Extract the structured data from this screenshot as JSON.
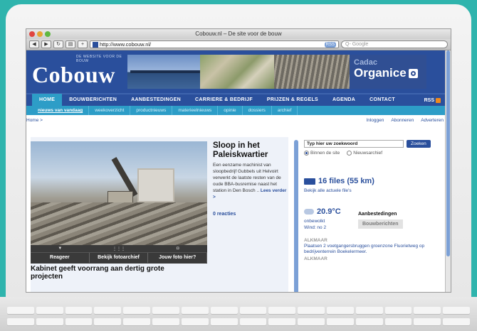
{
  "browser": {
    "window_title": "Cobouw.nl – De site voor de bouw",
    "url": "http://www.cobouw.nl/",
    "rss_badge": "RSS",
    "search_placeholder": "Q- Google",
    "traffic_light_colors": [
      "#e0443e",
      "#e6a532",
      "#5fb840"
    ]
  },
  "site": {
    "logo_tagline": "DE WEBSITE VOOR DE BOUW",
    "logo": "Cobouw",
    "banner_kicker": "Cadac",
    "banner_brand": "Organice",
    "brand_color": "#2a4f9c",
    "accent_color": "#2d9dc7"
  },
  "nav": {
    "items": [
      {
        "label": "HOME",
        "active": true
      },
      {
        "label": "BOUWBERICHTEN",
        "active": false
      },
      {
        "label": "AANBESTEDINGEN",
        "active": false
      },
      {
        "label": "CARRIERE & BEDRIJF",
        "active": false
      },
      {
        "label": "PRIJZEN & REGELS",
        "active": false
      },
      {
        "label": "AGENDA",
        "active": false
      },
      {
        "label": "CONTACT",
        "active": false
      }
    ],
    "rss_label": "RSS"
  },
  "subnav": {
    "items": [
      "nieuws van vandaag",
      "weekoverzicht",
      "productnieuws",
      "materieelnieuws",
      "opinie",
      "dossiers",
      "archief"
    ]
  },
  "breadcrumb": "Home >",
  "user_links": [
    "Inloggen",
    "Abonneren",
    "Adverteren"
  ],
  "feature": {
    "controls": [
      "Reageer",
      "Bekijk fotoarchief",
      "Jouw foto hier?"
    ],
    "second_headline": "Kabinet geeft voorrang aan dertig grote projecten"
  },
  "article": {
    "title": "Sloop in het Paleiskwartier",
    "body": "Een eenzame machinist van sloopbedrijf Gubbels uit Helvoirt verwerkt de laatste resten van de oude BBA-busremise naast het station in Den Bosch ..",
    "more": "Lees verder >",
    "reactions": "0 reacties"
  },
  "sidebar": {
    "search_value": "Typ hier uw zoekwoord",
    "search_button": "Zoeken",
    "radio_site": "Binnen de site",
    "radio_archive": "Nieuwsarchief",
    "files_title": "16 files (55 km)",
    "files_link": "Bekijk alle actuele file's",
    "temperature": "20.9°C",
    "weather_desc": "onbewolkt",
    "wind": "Wind: no 2",
    "tender_title": "Aanbestedingen",
    "tender_button": "Bouwberichten",
    "news_location": "ALKMAAR",
    "news_text": "Plaatsen 2 voetgangersbruggen groenzone Fluorietweg op bedrijventerrein Boekelermeer.",
    "news_location_2": "ALKMAAR"
  }
}
